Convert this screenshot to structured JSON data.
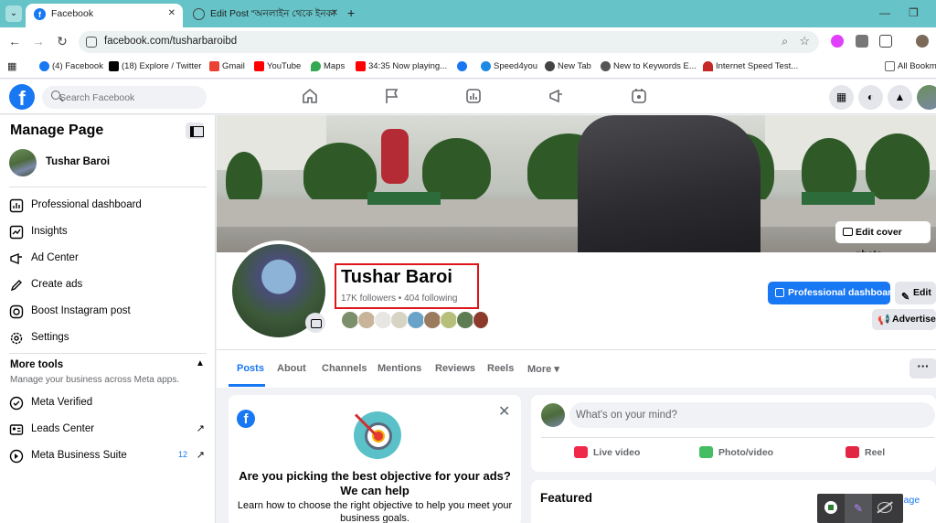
{
  "browser": {
    "tabs": [
      {
        "title": "Facebook",
        "active": true
      },
      {
        "title": "Edit Post “অনলাইন থেকে ইনকা",
        "active": false
      }
    ],
    "url": "facebook.com/tusharbaroibd",
    "bookmarks": [
      {
        "label": "(4) Facebook",
        "color": "#1877f2"
      },
      {
        "label": "(18) Explore / Twitter",
        "color": "#000000"
      },
      {
        "label": "Gmail",
        "color": "#ea4335"
      },
      {
        "label": "YouTube",
        "color": "#ff0000"
      },
      {
        "label": "Maps",
        "color": "#34a853"
      },
      {
        "label": "34:35 Now playing...",
        "color": "#ff0000"
      },
      {
        "label": "",
        "color": "#1877f2"
      },
      {
        "label": "Speed4you",
        "color": "#1e88e5"
      },
      {
        "label": "New Tab",
        "color": "#444444"
      },
      {
        "label": "New to Keywords E...",
        "color": "#555555"
      },
      {
        "label": "Internet Speed Test...",
        "color": "#c62828"
      },
      {
        "label": "All Bookm",
        "color": "#666666"
      }
    ]
  },
  "facebook": {
    "search_placeholder": "Search Facebook"
  },
  "sidebar": {
    "title": "Manage Page",
    "page_name": "Tushar Baroi",
    "items": [
      {
        "label": "Professional dashboard"
      },
      {
        "label": "Insights"
      },
      {
        "label": "Ad Center"
      },
      {
        "label": "Create ads"
      },
      {
        "label": "Boost Instagram post"
      },
      {
        "label": "Settings"
      }
    ],
    "more_tools": {
      "title": "More tools",
      "subtitle": "Manage your business across Meta apps."
    },
    "tools": [
      {
        "label": "Meta Verified"
      },
      {
        "label": "Leads Center"
      },
      {
        "label": "Meta Business Suite",
        "badge": "12"
      }
    ]
  },
  "profile": {
    "edit_cover": "Edit cover photo",
    "name": "Tushar Baroi",
    "stats": "17K followers • 404 following",
    "buttons": {
      "professional_dashboard": "Professional dashboard",
      "edit": "Edit",
      "advertise": "Advertise"
    },
    "tabs": [
      "Posts",
      "About",
      "Channels",
      "Mentions",
      "Reviews",
      "Reels",
      "More ▾"
    ],
    "more_dots": "···"
  },
  "ad_card": {
    "question": "Are you picking the best objective for your ads? We can help",
    "description": "Learn how to choose the right objective to help you meet your business goals."
  },
  "composer": {
    "placeholder": "What's on your mind?",
    "actions": [
      "Live video",
      "Photo/video",
      "Reel"
    ]
  },
  "featured": {
    "title": "Featured",
    "manage": "anage"
  },
  "colors": {
    "tab_strip": "#66c3c7",
    "facebook_blue": "#1877f2",
    "highlight_box": "#e0151a"
  }
}
